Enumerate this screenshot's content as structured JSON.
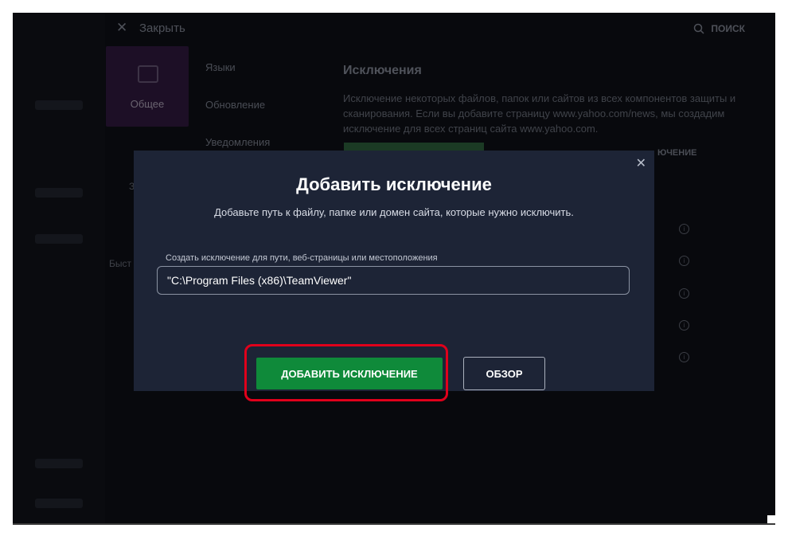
{
  "app": {
    "close_label": "Закрыть",
    "search_label": "ПОИСК",
    "tile_label": "Общее",
    "menu_items": [
      "Языки",
      "Обновление",
      "Уведомления"
    ],
    "side_fragments": [
      "З",
      "Быст"
    ],
    "section_title": "Исключения",
    "section_description": "Исключение некоторых файлов, папок или сайтов из всех компонентов защиты и сканирования. Если вы добавите страницу www.yahoo.com/news, мы создадим исключение для всех страниц сайта www.yahoo.com.",
    "column_fragment": "ЮЧЕНИЕ",
    "info_icon": "info-icon"
  },
  "modal": {
    "close_icon": "close-icon",
    "title": "Добавить исключение",
    "subtitle": "Добавьте путь к файлу, папке или домен сайта, которые нужно исключить.",
    "field_label": "Создать исключение для пути, веб-страницы или местоположения",
    "field_value": "\"C:\\Program Files (x86)\\TeamViewer\"",
    "add_button": "ДОБАВИТЬ ИСКЛЮЧЕНИЕ",
    "browse_button": "ОБЗОР"
  },
  "colors": {
    "modal_bg": "#1d2436",
    "accent_green": "#0f8a3a",
    "highlight_red": "#e0001b",
    "window_bg": "#08090d"
  }
}
